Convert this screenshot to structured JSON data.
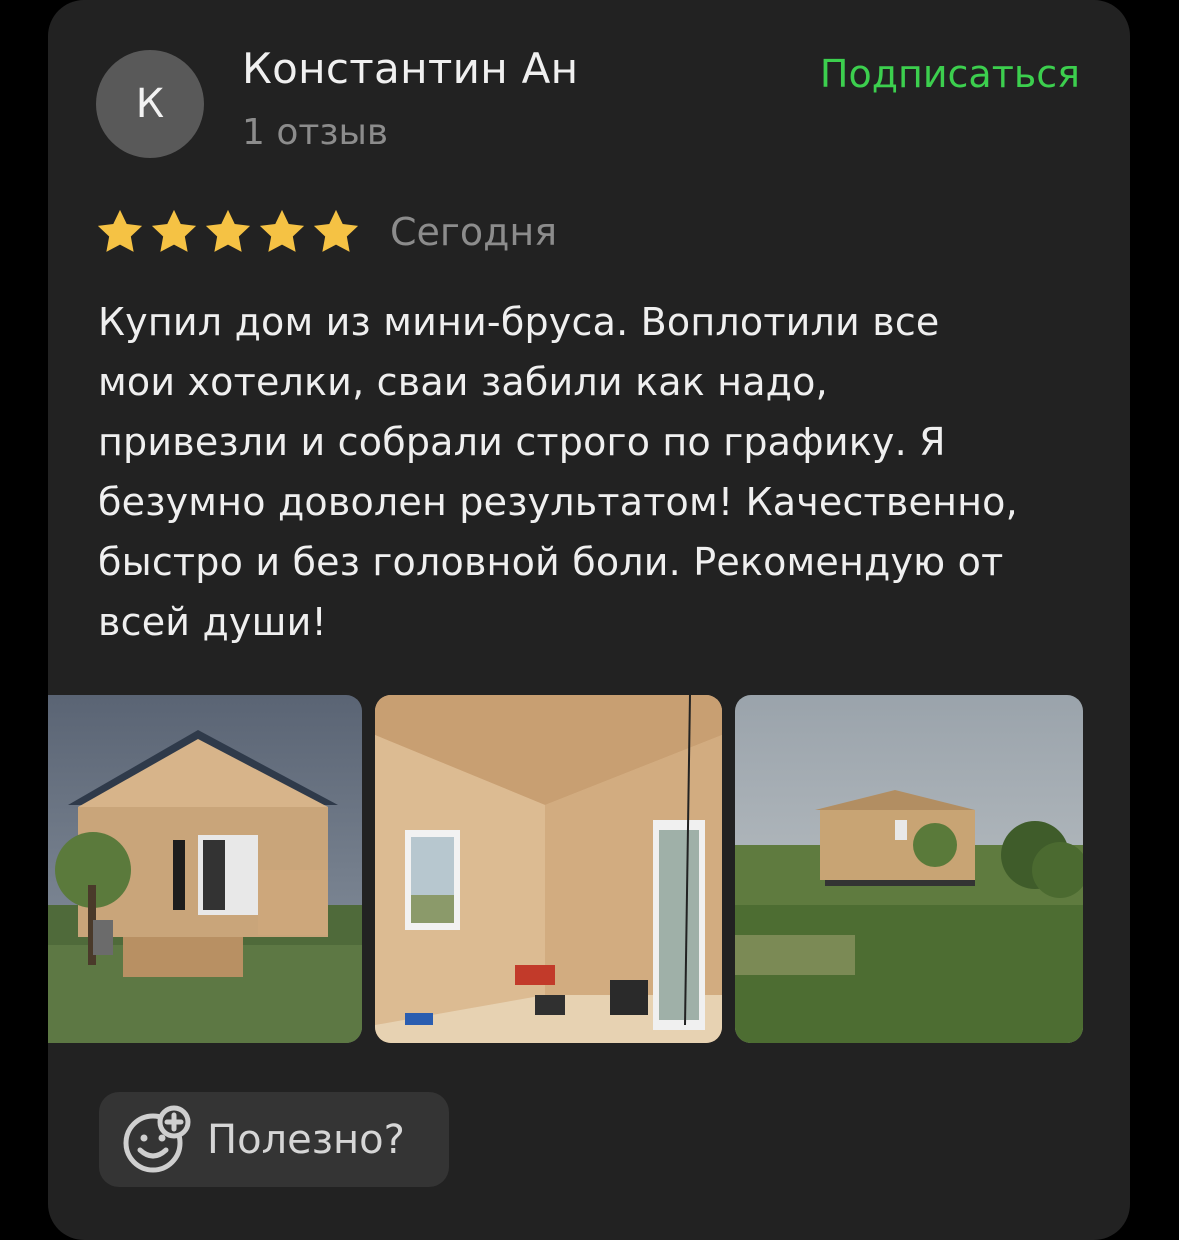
{
  "author": {
    "initial": "К",
    "name": "Константин Ан",
    "reviews_count": "1 отзыв"
  },
  "subscribe_label": "Подписаться",
  "rating": {
    "value": 5,
    "max": 5
  },
  "date": "Сегодня",
  "review_lines": [
    "Купил дом из мини-бруса. Воплотили все",
    "мои хотелки, сваи забили как надо,",
    "привезли и собрали строго по графику. Я",
    "безумно доволен результатом! Качественно,",
    "быстро и без головной боли. Рекомендую от",
    "всей души!"
  ],
  "photos": [
    {
      "icon": "house-exterior-photo"
    },
    {
      "icon": "house-interior-photo"
    },
    {
      "icon": "house-field-photo"
    }
  ],
  "helpful_label": "Полезно?",
  "colors": {
    "accent_green": "#3ccf4e",
    "star": "#f5c244",
    "card_bg": "#222222"
  }
}
